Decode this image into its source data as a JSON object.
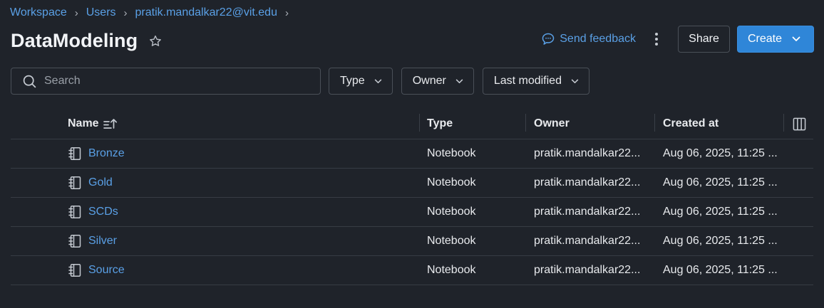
{
  "breadcrumb": {
    "items": [
      "Workspace",
      "Users",
      "pratik.mandalkar22@vit.edu"
    ]
  },
  "page": {
    "title": "DataModeling"
  },
  "actions": {
    "feedback": "Send feedback",
    "share": "Share",
    "create": "Create"
  },
  "filters": {
    "search_placeholder": "Search",
    "type": "Type",
    "owner": "Owner",
    "last_modified": "Last modified"
  },
  "table": {
    "columns": {
      "name": "Name",
      "type": "Type",
      "owner": "Owner",
      "created": "Created at"
    },
    "rows": [
      {
        "name": "Bronze",
        "type": "Notebook",
        "owner": "pratik.mandalkar22...",
        "created": "Aug 06, 2025, 11:25 ..."
      },
      {
        "name": "Gold",
        "type": "Notebook",
        "owner": "pratik.mandalkar22...",
        "created": "Aug 06, 2025, 11:25 ..."
      },
      {
        "name": "SCDs",
        "type": "Notebook",
        "owner": "pratik.mandalkar22...",
        "created": "Aug 06, 2025, 11:25 ..."
      },
      {
        "name": "Silver",
        "type": "Notebook",
        "owner": "pratik.mandalkar22...",
        "created": "Aug 06, 2025, 11:25 ..."
      },
      {
        "name": "Source",
        "type": "Notebook",
        "owner": "pratik.mandalkar22...",
        "created": "Aug 06, 2025, 11:25 ..."
      }
    ]
  },
  "icons": {
    "star": "star-outline-icon",
    "feedback": "chat-bubble-icon",
    "kebab": "vertical-dots-icon",
    "search": "magnifier-icon",
    "chevron": "chevron-down-icon",
    "sort": "sort-ascending-icon",
    "columns": "column-settings-icon",
    "notebook": "notebook-icon"
  },
  "colors": {
    "background": "#1f232a",
    "link": "#5aa0e6",
    "primary": "#2f86d8",
    "border": "#4a5058"
  }
}
